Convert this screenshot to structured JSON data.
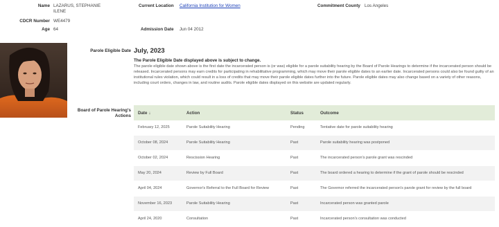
{
  "profile": {
    "name_label": "Name",
    "name_value_line1": "LAZARUS, STEPHANIE",
    "name_value_line2": "ILENE",
    "cdcr_label": "CDCR Number",
    "cdcr_value": "WE4479",
    "age_label": "Age",
    "age_value": "64",
    "location_label": "Current Location",
    "location_value": "California Institution for Women",
    "admission_label": "Admission Date",
    "admission_value": "Jun 04 2012",
    "county_label": "Commitment County",
    "county_value": "Los Angeles"
  },
  "parole": {
    "label": "Parole Eligible Date",
    "date": "July, 2023",
    "notice_title": "The Parole Eligible Date displayed above is subject to change.",
    "notice_body": "The parole eligible date shown above is the first date the incarcerated person is (or was) eligible for a parole suitability hearing by the Board of Parole Hearings to determine if the incarcerated person should be released. Incarcerated persons may earn credits for participating in rehabilitative programming, which may move their parole eligible dates to an earlier date. Incarcerated persons could also be found guilty of an institutional rules violation, which could result in a loss of credits that may move their parole eligible dates further into the future. Parole eligible dates may also change based on a variety of other reasons, including court orders, changes in law, and routine audits. Parole eligible dates displayed on this website are updated regularly."
  },
  "board": {
    "label_line1": "Board of Parole Hearing's",
    "label_line2": "Actions",
    "columns": {
      "date": "Date",
      "sort_arrow": "↓",
      "action": "Action",
      "status": "Status",
      "outcome": "Outcome"
    },
    "rows": [
      {
        "date": "February 12, 2025",
        "action": "Parole Suitability Hearing",
        "status": "Pending",
        "outcome": "Tentative date for parole suitability hearing"
      },
      {
        "date": "October 08, 2024",
        "action": "Parole Suitability Hearing",
        "status": "Past",
        "outcome": "Parole suitability hearing was postponed"
      },
      {
        "date": "October 02, 2024",
        "action": "Rescission Hearing",
        "status": "Past",
        "outcome": "The incarcerated person's parole grant was rescinded"
      },
      {
        "date": "May 20, 2024",
        "action": "Review by Full Board",
        "status": "Past",
        "outcome": "The board ordered a hearing to determine if the grant of parole should be rescinded"
      },
      {
        "date": "April 04, 2024",
        "action": "Governor's Referral to the Full Board for Review",
        "status": "Past",
        "outcome": "The Governor referred the incarcerated person's parole grant for review by the full board"
      },
      {
        "date": "November 16, 2023",
        "action": "Parole Suitability Hearing",
        "status": "Past",
        "outcome": "Incarcerated person was granted parole"
      },
      {
        "date": "April 24, 2020",
        "action": "Consultation",
        "status": "Past",
        "outcome": "Incarcerated person's consultation was conducted"
      }
    ]
  }
}
